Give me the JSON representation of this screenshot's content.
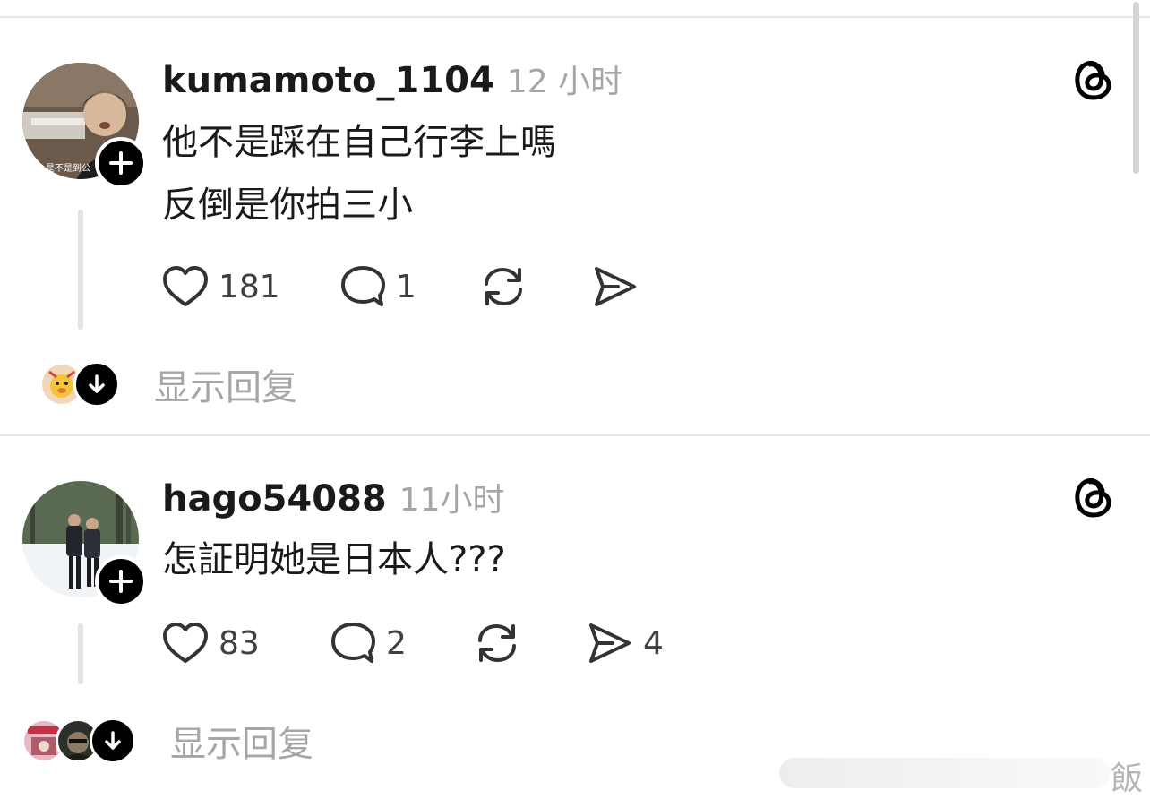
{
  "posts": [
    {
      "username": "kumamoto_1104",
      "time": "12 小时",
      "text_lines": [
        "他不是踩在自己行李上嗎",
        "反倒是你拍三小"
      ],
      "avatar_caption": "是不是到公",
      "likes": "181",
      "comments": "1",
      "shares": "",
      "show_replies": "显示回复"
    },
    {
      "username": "hago54088",
      "time": "11小时",
      "text_lines": [
        "怎証明她是日本人???"
      ],
      "likes": "83",
      "comments": "2",
      "shares": "4",
      "show_replies": "显示回复"
    }
  ],
  "watermark_char": "飯",
  "icons": {
    "like": "heart-icon",
    "comment": "speech-bubble-icon",
    "repost": "repost-icon",
    "share": "send-icon",
    "brand": "threads-logo-icon",
    "follow": "plus-icon",
    "expand": "arrow-down-icon"
  },
  "colors": {
    "text": "#1a1a1a",
    "muted": "#a6a6a6",
    "divider": "#e6e6e6",
    "badge": "#000000"
  }
}
